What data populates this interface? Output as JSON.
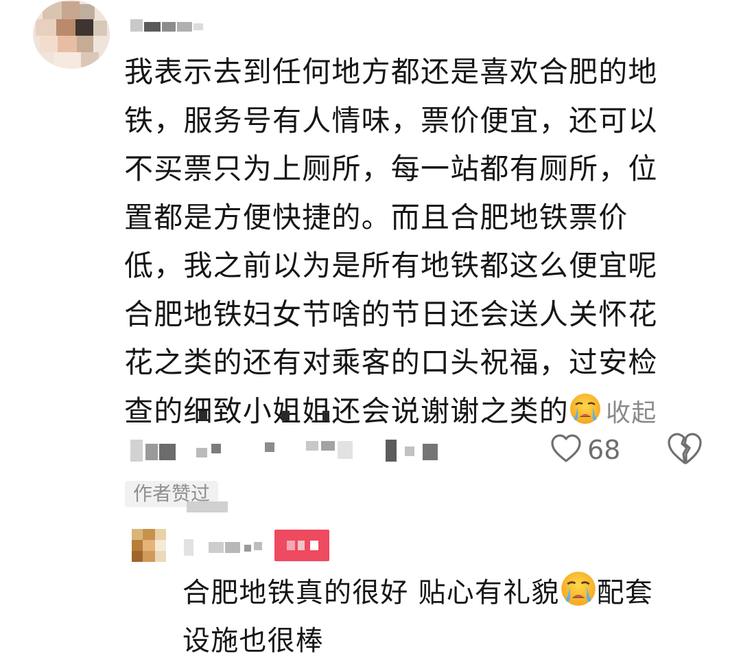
{
  "comment": {
    "lines": [
      "我表示去到任何地方都还是喜欢合肥的地",
      "铁，服务号有人情味，票价便宜，还可以",
      "不买票只为上厕所，每一站都有厕所，位",
      "置都是方便快捷的。而且合肥地铁票价",
      "低，我之前以为是所有地铁都这么便宜呢",
      "合肥地铁妇女节啥的节日还会送人关怀花",
      "花之类的还有对乘客的口头祝福，过安检",
      "查的细致小姐姐还会说谢谢之类的"
    ],
    "emoji": "crying-face-emoji",
    "collapse_label": "收起",
    "like_count": "68",
    "author_liked_label": "作者赞过"
  },
  "reply": {
    "text_part1": "合肥地铁真的很好 贴心有礼貌",
    "text_part2": "配套",
    "text_line2": "设施也很棒",
    "emoji": "crying-face-emoji"
  },
  "colors": {
    "text": "#161616",
    "muted": "#8a8a8a",
    "badge": "#ee4a60",
    "tag_bg": "#f1f1f1"
  }
}
